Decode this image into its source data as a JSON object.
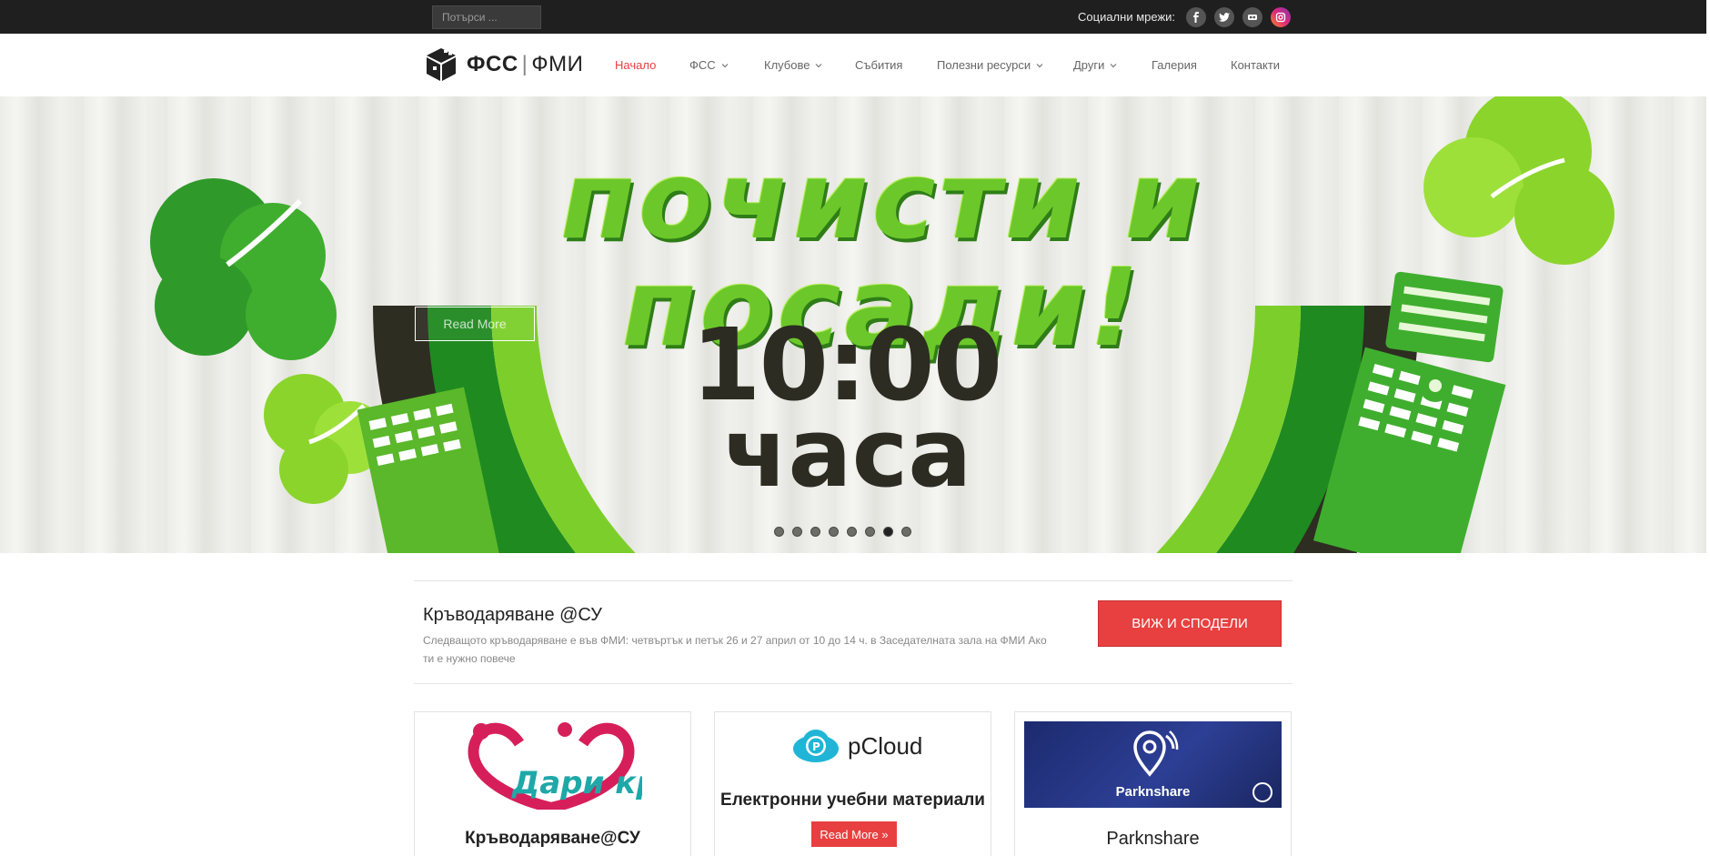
{
  "topbar": {
    "search_placeholder": "Потърси ...",
    "social_label": "Социални мрежи:",
    "social_icons": [
      "facebook-icon",
      "twitter-icon",
      "flickr-icon",
      "instagram-icon"
    ]
  },
  "logo": {
    "text_a": "ФСС",
    "text_b": "ФМИ"
  },
  "nav": {
    "items": [
      {
        "label": "Начало",
        "active": true,
        "dropdown": false
      },
      {
        "label": "ФСС",
        "active": false,
        "dropdown": true
      },
      {
        "label": "Клубове",
        "active": false,
        "dropdown": true
      },
      {
        "label": "Събития",
        "active": false,
        "dropdown": false
      },
      {
        "label": "Полезни ресурси",
        "active": false,
        "dropdown": true
      },
      {
        "label": "Други",
        "active": false,
        "dropdown": true
      },
      {
        "label": "Галерия",
        "active": false,
        "dropdown": false
      },
      {
        "label": "Контакти",
        "active": false,
        "dropdown": false
      }
    ]
  },
  "hero": {
    "title": "почисти и посади!",
    "time": "10:00",
    "hours": "часа",
    "read_more": "Read More",
    "slides_count": 8,
    "active_slide": 7
  },
  "info": {
    "title": "Кръводаряване @СУ",
    "text": "Следващото кръводаряване е във ФМИ: четвъртък и петък 26 и 27 април от 10 до 14 ч. в Заседателната зала на ФМИ Ако ти е нужно повече",
    "cta": "ВИЖ И СПОДЕЛИ"
  },
  "cards": [
    {
      "title": "Кръводаряване@СУ",
      "logo_text": "Дари кръв"
    },
    {
      "title": "Електронни учебни материали",
      "logo_text": "pCloud",
      "button": "Read More »"
    },
    {
      "title": "Parknshare",
      "logo_text": "Parknshare"
    }
  ],
  "colors": {
    "accent": "#e84040",
    "topbar": "#1f1f1f",
    "hero_green": "#6cc82a",
    "dark_green": "#2f7d18"
  }
}
